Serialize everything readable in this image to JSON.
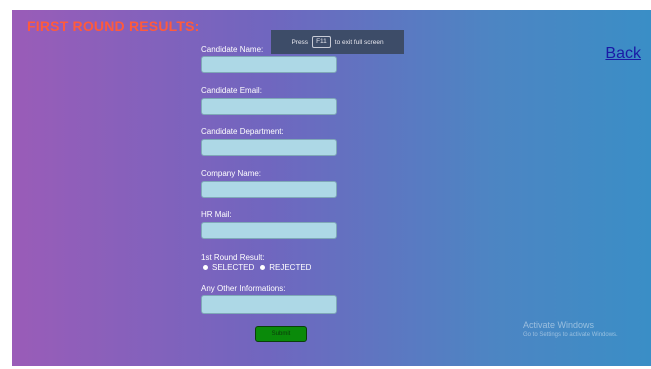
{
  "page": {
    "title": "FIRST ROUND RESULTS:",
    "back_label": "Back"
  },
  "fullscreen_toast": {
    "prefix": "Press",
    "key": "F11",
    "suffix": "to exit full screen"
  },
  "form": {
    "fields": [
      {
        "label": "Candidate Name:",
        "value": ""
      },
      {
        "label": "Candidate Email:",
        "value": ""
      },
      {
        "label": "Candidate Department:",
        "value": ""
      },
      {
        "label": "Company Name:",
        "value": ""
      },
      {
        "label": "HR Mail:",
        "value": ""
      }
    ],
    "result": {
      "label": "1st Round Result:",
      "options": [
        "SELECTED",
        "REJECTED"
      ]
    },
    "other": {
      "label": "Any Other Informations:",
      "value": ""
    },
    "submit_label": "Submit"
  },
  "watermark": {
    "title": "Activate Windows",
    "subtitle": "Go to Settings to activate Windows."
  },
  "colors": {
    "title": "#ff5a3c",
    "input_bg": "#add8e6",
    "submit_bg": "#0a8a0a",
    "gradient_left": "#9a5cb8",
    "gradient_right": "#3a8ec6"
  }
}
